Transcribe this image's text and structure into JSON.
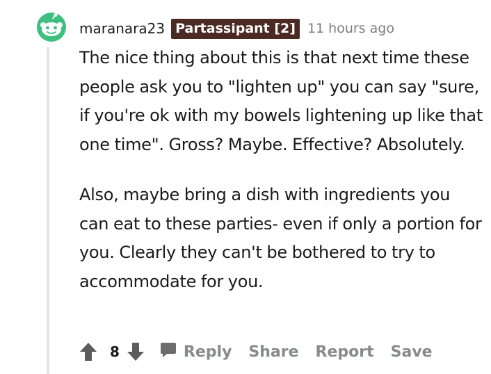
{
  "comment": {
    "username": "maranara23",
    "flair": "Partassipant [2]",
    "timestamp": "11 hours ago",
    "paragraphs": [
      "The nice thing about this is that next time these people ask you to \"lighten up\" you can say \"sure, if you're ok with my bowels lightening up like that one time\". Gross? Maybe. Effective? Absolutely.",
      "Also, maybe bring a dish with ingredients you can eat to these parties- even if only a portion for you. Clearly they can't be bothered to try to accommodate for you."
    ],
    "votes": "8"
  },
  "actions": {
    "reply": "Reply",
    "share": "Share",
    "report": "Report",
    "save": "Save"
  },
  "icons": {
    "avatar": "snoo-avatar-icon",
    "upvote": "upvote-arrow-icon",
    "downvote": "downvote-arrow-icon",
    "reply": "comment-bubble-icon"
  },
  "colors": {
    "flair_bg": "#4a2a22",
    "avatar_green": "#3fbf7f",
    "muted": "#878a8c"
  }
}
